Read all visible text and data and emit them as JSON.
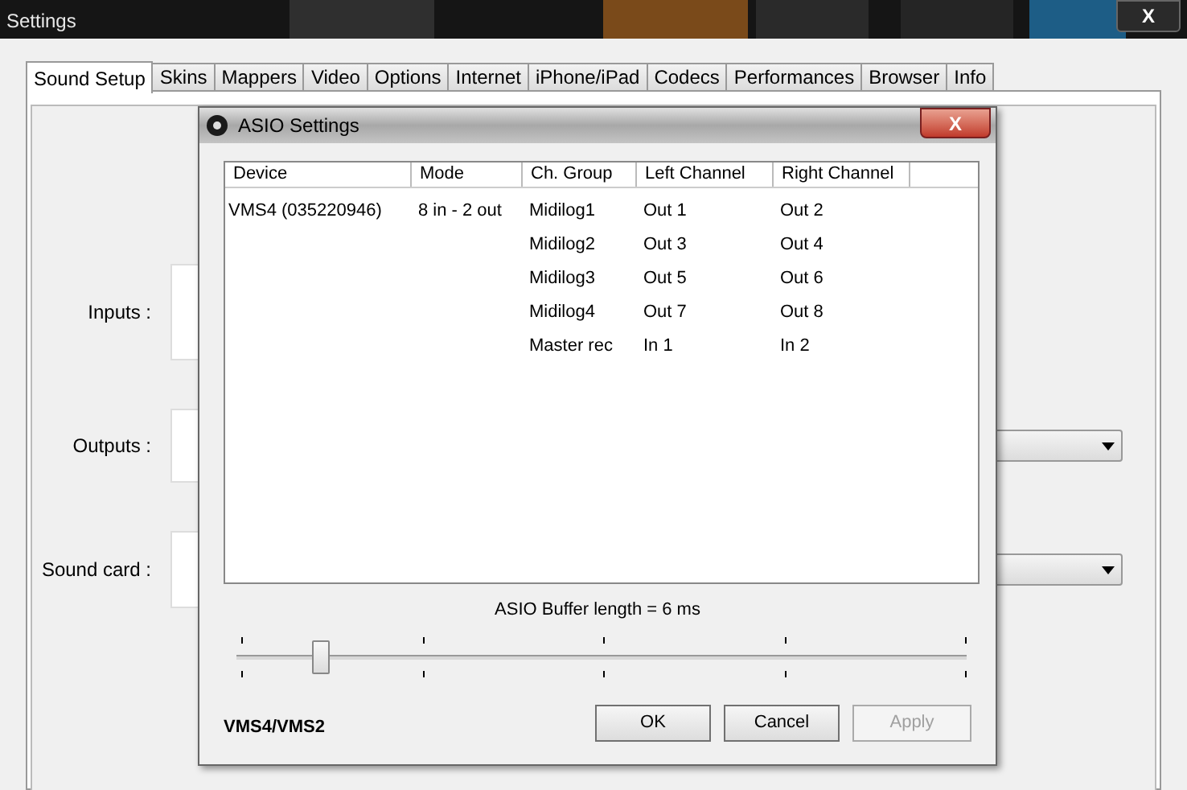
{
  "window": {
    "title": "Settings",
    "close": "X"
  },
  "tabs": [
    {
      "label": "Sound Setup",
      "selected": true
    },
    {
      "label": "Skins",
      "selected": false
    },
    {
      "label": "Mappers",
      "selected": false
    },
    {
      "label": "Video",
      "selected": false
    },
    {
      "label": "Options",
      "selected": false
    },
    {
      "label": "Internet",
      "selected": false
    },
    {
      "label": "iPhone/iPad",
      "selected": false
    },
    {
      "label": "Codecs",
      "selected": false
    },
    {
      "label": "Performances",
      "selected": false
    },
    {
      "label": "Browser",
      "selected": false
    },
    {
      "label": "Info",
      "selected": false
    }
  ],
  "sound_setup": {
    "fields": [
      {
        "label": "Inputs :",
        "dropdown": false
      },
      {
        "label": "Outputs :",
        "dropdown": true
      },
      {
        "label": "Sound card :",
        "dropdown": true
      }
    ]
  },
  "dialog": {
    "title": "ASIO Settings",
    "close": "X",
    "table": {
      "columns": [
        "Device",
        "Mode",
        "Ch. Group",
        "Left Channel",
        "Right Channel"
      ],
      "rows": [
        [
          "VMS4 (035220946)",
          "8 in - 2 out",
          "Midilog1",
          "Out 1",
          "Out 2"
        ],
        [
          "",
          "",
          "Midilog2",
          "Out 3",
          "Out 4"
        ],
        [
          "",
          "",
          "Midilog3",
          "Out 5",
          "Out 6"
        ],
        [
          "",
          "",
          "Midilog4",
          "Out 7",
          "Out 8"
        ],
        [
          "",
          "",
          "Master rec",
          "In 1",
          "In 2"
        ]
      ]
    },
    "buffer_label": "ASIO Buffer length = 6 ms",
    "slider": {
      "level": 0.115
    },
    "device_name": "VMS4/VMS2",
    "buttons": [
      {
        "label": "OK",
        "disabled": false
      },
      {
        "label": "Cancel",
        "disabled": false
      },
      {
        "label": "Apply",
        "disabled": true
      }
    ]
  }
}
